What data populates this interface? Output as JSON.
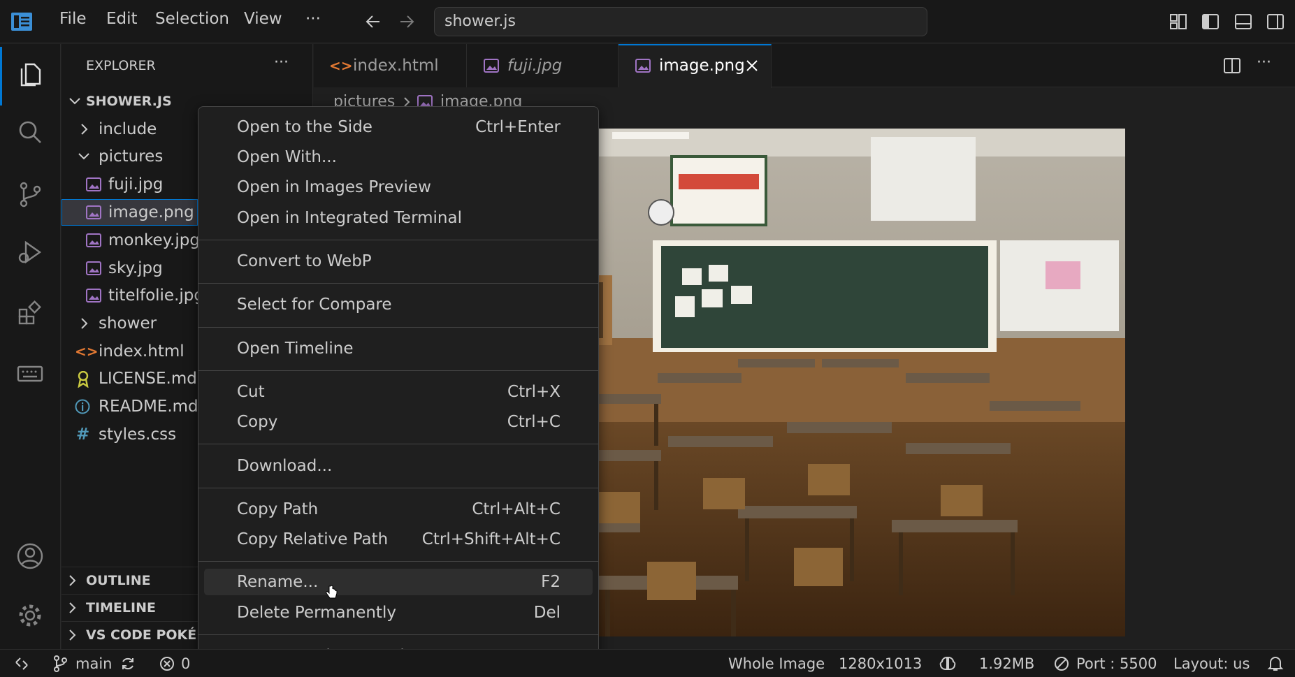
{
  "titlebar": {
    "menus": [
      "File",
      "Edit",
      "Selection",
      "View",
      "···"
    ],
    "command_center": "shower.js"
  },
  "explorer": {
    "title": "EXPLORER",
    "more": "···",
    "workspace": "SHOWER.JS",
    "items": [
      {
        "label": "include",
        "kind": "folder"
      },
      {
        "label": "pictures",
        "kind": "folder-open"
      },
      {
        "label": "fuji.jpg",
        "kind": "image"
      },
      {
        "label": "image.png",
        "kind": "image"
      },
      {
        "label": "monkey.jpg",
        "kind": "image"
      },
      {
        "label": "sky.jpg",
        "kind": "image"
      },
      {
        "label": "titelfolie.jpg",
        "kind": "image"
      },
      {
        "label": "shower",
        "kind": "folder"
      },
      {
        "label": "index.html",
        "kind": "html"
      },
      {
        "label": "LICENSE.md",
        "kind": "license"
      },
      {
        "label": "README.md",
        "kind": "info"
      },
      {
        "label": "styles.css",
        "kind": "css"
      }
    ],
    "sections": [
      "OUTLINE",
      "TIMELINE",
      "VS CODE POKÉMON"
    ]
  },
  "tabs": [
    {
      "label": "index.html",
      "icon": "html-icon"
    },
    {
      "label": "fuji.jpg",
      "icon": "image-icon"
    },
    {
      "label": "image.png",
      "icon": "image-icon"
    }
  ],
  "breadcrumb": {
    "folder": "pictures",
    "file": "image.png"
  },
  "context_menu": {
    "items": [
      {
        "label": "Open to the Side",
        "key": "Ctrl+Enter"
      },
      {
        "label": "Open With...",
        "key": ""
      },
      {
        "label": "Open in Images Preview",
        "key": ""
      },
      {
        "label": "Open in Integrated Terminal",
        "key": ""
      },
      {
        "label": "Convert to WebP",
        "key": ""
      },
      {
        "label": "Select for Compare",
        "key": ""
      },
      {
        "label": "Open Timeline",
        "key": ""
      },
      {
        "label": "Cut",
        "key": "Ctrl+X"
      },
      {
        "label": "Copy",
        "key": "Ctrl+C"
      },
      {
        "label": "Download...",
        "key": ""
      },
      {
        "label": "Copy Path",
        "key": "Ctrl+Alt+C"
      },
      {
        "label": "Copy Relative Path",
        "key": "Ctrl+Shift+Alt+C"
      },
      {
        "label": "Rename...",
        "key": "F2"
      },
      {
        "label": "Delete Permanently",
        "key": "Del"
      },
      {
        "label": "Export Workspace Diagrams",
        "key": ""
      }
    ]
  },
  "statusbar": {
    "branch": "main",
    "errors": "0",
    "zoom": "Whole Image",
    "dimensions": "1280x1013",
    "size": "1.92MB",
    "port": "Port : 5500",
    "layout": "Layout: us"
  },
  "colors": {
    "accent": "#0078d4",
    "image_icon": "#a074c4",
    "html_icon": "#e37933",
    "css_icon": "#519aba",
    "info_icon": "#519aba",
    "license_icon": "#cbcb41"
  }
}
